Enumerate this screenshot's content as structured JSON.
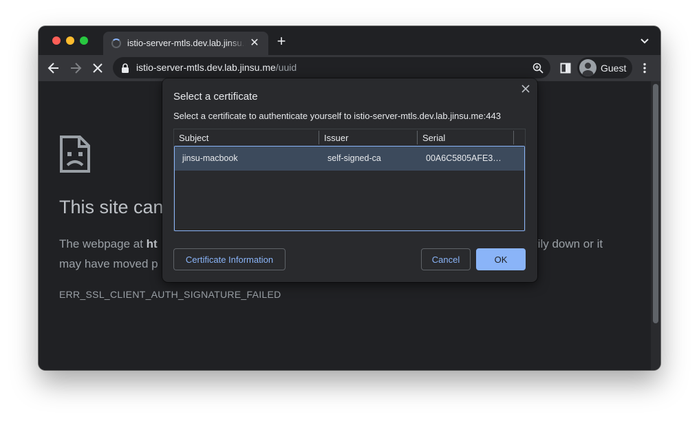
{
  "browser": {
    "tab": {
      "title": "istio-server-mtls.dev.lab.jinsu.me/uuid"
    },
    "address_bar": {
      "host": "istio-server-mtls.dev.lab.jinsu.me",
      "path": "/uuid"
    },
    "profile": {
      "label": "Guest"
    },
    "icons": [
      "back-arrow-icon",
      "forward-arrow-icon",
      "stop-icon",
      "lock-icon",
      "zoom-icon",
      "side-panel-icon",
      "guest-avatar-icon",
      "more-menu-icon",
      "new-tab-icon",
      "tab-close-icon",
      "tab-list-chevron-icon",
      "loading-spinner-icon"
    ]
  },
  "error_page": {
    "title": "This site can",
    "body_prefix": "The webpage at ",
    "body_bold": "ht",
    "body_suffix": "rily down or it",
    "body_line2": "may have moved p",
    "error_code": "ERR_SSL_CLIENT_AUTH_SIGNATURE_FAILED",
    "icon": "sad-page-icon"
  },
  "dialog": {
    "title": "Select a certificate",
    "description": "Select a certificate to authenticate yourself to istio-server-mtls.dev.lab.jinsu.me:443",
    "columns": [
      "Subject",
      "Issuer",
      "Serial"
    ],
    "rows": [
      {
        "subject": "jinsu-macbook",
        "issuer": "self-signed-ca",
        "serial": "00A6C5805AFE3…",
        "selected": true
      }
    ],
    "buttons": {
      "info": "Certificate Information",
      "cancel": "Cancel",
      "ok": "OK"
    }
  },
  "colors": {
    "frame": "#202124",
    "toolbar": "#35363a",
    "accent": "#8ab4f8",
    "selected_row": "#3c4a5c"
  }
}
